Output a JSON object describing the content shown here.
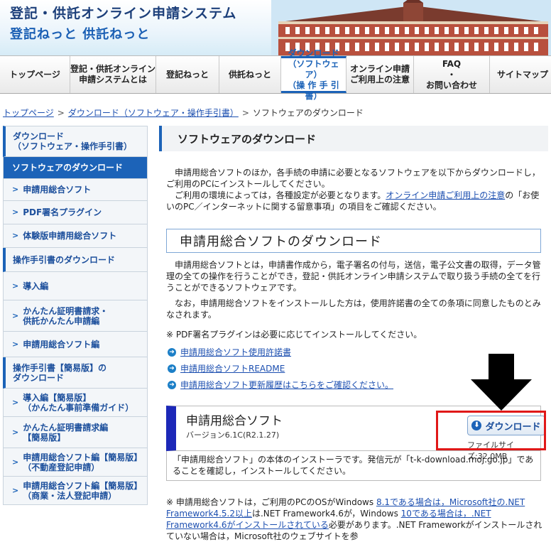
{
  "header": {
    "title": "登記・供託オンライン申請システム",
    "subtitle": "登記ねっと 供託ねっと"
  },
  "nav": {
    "items": [
      {
        "label": "トップページ"
      },
      {
        "label": "登記・供託オンライン\n申請システムとは"
      },
      {
        "label": "登記ねっと"
      },
      {
        "label": "供託ねっと"
      },
      {
        "label": "ダウンロード\n（ソフトウェア）\n（操 作 手 引 書）"
      },
      {
        "label": "オンライン申請\nご利用上の注意"
      },
      {
        "label": "FAQ\n・\nお問い合わせ"
      },
      {
        "label": "サイトマップ"
      }
    ]
  },
  "breadcrumb": {
    "link1": "トップページ",
    "link2": "ダウンロード（ソフトウェア・操作手引書）",
    "current": "ソフトウェアのダウンロード"
  },
  "sidebar": {
    "items": [
      {
        "label": "ダウンロード\n（ソフトウェア・操作手引書）"
      },
      {
        "label": "ソフトウェアのダウンロード"
      },
      {
        "label": "申請用総合ソフト"
      },
      {
        "label": "PDF署名プラグイン"
      },
      {
        "label": "体験版申請用総合ソフト"
      },
      {
        "label": "操作手引書のダウンロード"
      },
      {
        "label": "導入編"
      },
      {
        "label": "かんたん証明書請求・\n供託かんたん申請編"
      },
      {
        "label": "申請用総合ソフト編"
      },
      {
        "label": "操作手引書【簡易版】の\nダウンロード"
      },
      {
        "label": "導入編【簡易版】\n（かんたん事前準備ガイド）"
      },
      {
        "label": "かんたん証明書請求編\n【簡易版】"
      },
      {
        "label": "申請用総合ソフト編【簡易版】\n（不動産登記申請）"
      },
      {
        "label": "申請用総合ソフト編【簡易版】\n（商業・法人登記申請）"
      }
    ]
  },
  "main": {
    "heading": "ソフトウェアのダウンロード",
    "intro1": "申請用総合ソフトのほか，各手続の申請に必要となるソフトウェアを以下からダウンロードし，ご利用のPCにインストールしてください。",
    "intro2a": "ご利用の環境によっては，各種設定が必要となります。",
    "intro2_link": "オンライン申請ご利用上の注意",
    "intro2b": "の「お使いのPC／インターネットに関する留意事項」の項目をご確認ください。",
    "section_heading": "申請用総合ソフトのダウンロード",
    "desc1": "申請用総合ソフトとは，申請書作成から，電子署名の付与，送信，電子公文書の取得，データ管理の全ての操作を行うことができ，登記・供託オンライン申請システムで取り扱う手続の全てを行うことができるソフトウェアです。",
    "desc2": "なお，申請用総合ソフトをインストールした方は，使用許諾書の全ての条項に同意したものとみなされます。",
    "note_pdf": "※ PDF署名プラグインは必要に応じてインストールしてください。",
    "links": [
      "申請用総合ソフト使用許諾書",
      "申請用総合ソフトREADME",
      "申請用総合ソフト更新履歴はこちらをご確認ください。"
    ],
    "software": {
      "name": "申請用総合ソフト",
      "version": "バージョン6.1C(R2.1.27)",
      "download_label": "ダウンロード",
      "filesize": "ファイルサイズ:32.0MB",
      "description": "「申請用総合ソフト」の本体のインストーラです。発信元が「t-k-download.moj.go.jp」であることを確認し，インストールしてください。"
    },
    "footnote_a": "※ 申請用総合ソフトは，ご利用のPCのOSがWindows ",
    "footnote_link1": "8.1である場合は，Microsoft社の.NET",
    "footnote_link2": "Framework4.5.2以上",
    "footnote_b": "は.NET Framework4.6が，Windows ",
    "footnote_link3": "10である場合は，.NET",
    "footnote_link4": "Framework4.6がインストールされている",
    "footnote_c": "必要があります。.NET Frameworkがインストールされていない場合は，Microsoft社のウェブサイトを参"
  },
  "colors": {
    "accent": "#1c63b8",
    "highlight": "#e01818",
    "box_bar": "#1c28b8"
  }
}
